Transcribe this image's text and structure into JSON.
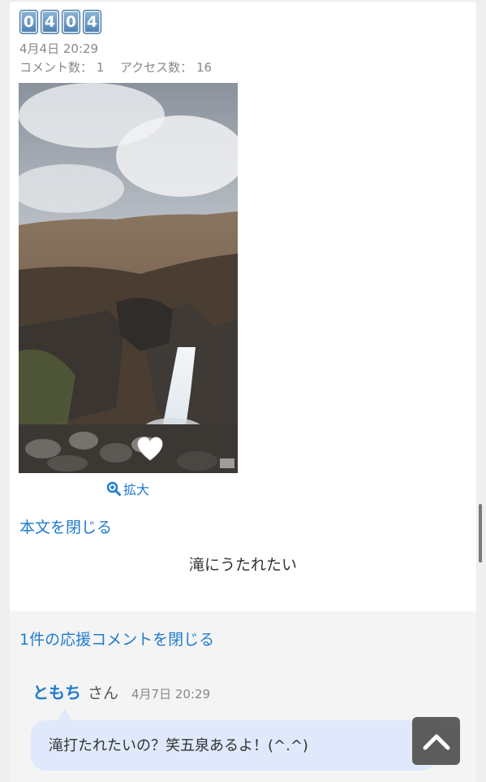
{
  "post": {
    "keycaps": [
      "0",
      "4",
      "0",
      "4"
    ],
    "date": "4月4日 20:29",
    "comment_label": "コメント数：",
    "comment_count": "1",
    "access_label": "アクセス数：",
    "access_count": "16",
    "zoom_label": "拡大",
    "toggle_body_label": "本文を閉じる",
    "body_text": "滝にうたれたい"
  },
  "comments": {
    "toggle_label": "1件の応援コメントを閉じる",
    "items": [
      {
        "name": "ともち",
        "honorific": "さん",
        "time": "4月7日 20:29",
        "text": "滝打たれたいの？笑五泉あるよ！(^.^)"
      }
    ]
  },
  "icons": {
    "zoom": "magnify-plus-icon",
    "like": "heart-icon",
    "scroll_top": "chevron-up-icon"
  },
  "colors": {
    "link": "#1e7bd0",
    "bubble": "#dfe9fb",
    "scroll_button": "#555555"
  }
}
